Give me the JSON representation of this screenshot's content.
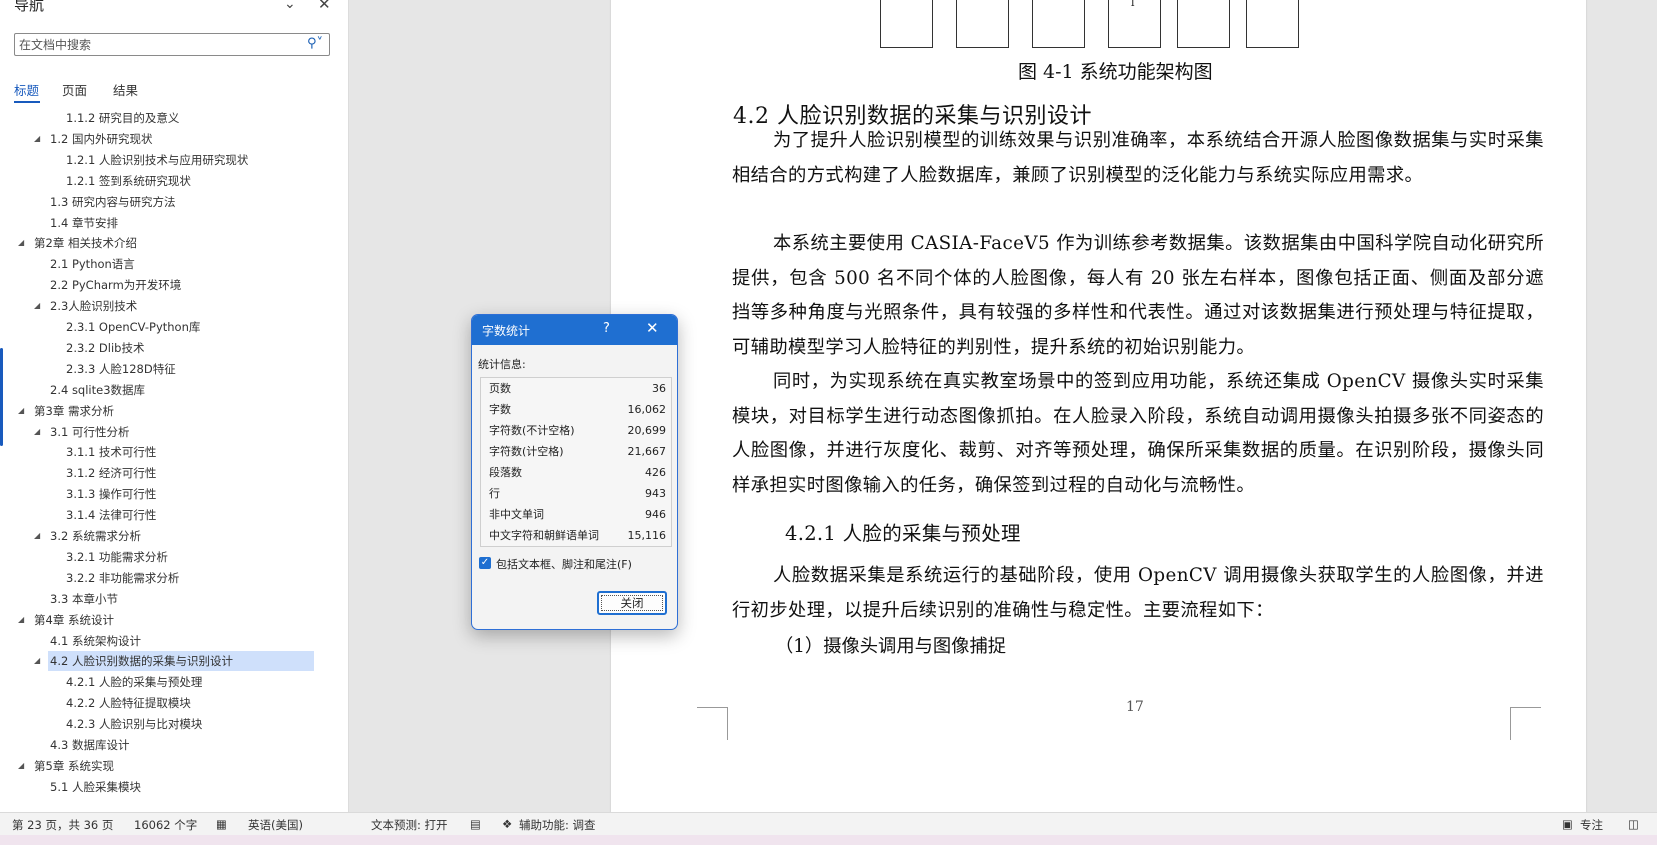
{
  "nav": {
    "title": "导航",
    "search_placeholder": "在文档中搜索",
    "tabs": [
      {
        "label": "标题",
        "active": true
      },
      {
        "label": "页面",
        "active": false
      },
      {
        "label": "结果",
        "active": false
      }
    ],
    "outline": [
      {
        "label": "1.1.2  研究目的及意义",
        "level": 3,
        "expanded": null,
        "selected": false
      },
      {
        "label": "1.2  国内外研究现状",
        "level": 2,
        "expanded": true,
        "selected": false
      },
      {
        "label": "1.2.1  人脸识别技术与应用研究现状",
        "level": 3,
        "expanded": null,
        "selected": false
      },
      {
        "label": "1.2.1  签到系统研究现状",
        "level": 3,
        "expanded": null,
        "selected": false
      },
      {
        "label": "1.3  研究内容与研究方法",
        "level": 2,
        "expanded": null,
        "selected": false
      },
      {
        "label": "1.4  章节安排",
        "level": 2,
        "expanded": null,
        "selected": false
      },
      {
        "label": "第2章  相关技术介绍",
        "level": 1,
        "expanded": true,
        "selected": false
      },
      {
        "label": "2.1 Python语言",
        "level": 2,
        "expanded": null,
        "selected": false
      },
      {
        "label": "2.2 PyCharm为开发环境",
        "level": 2,
        "expanded": null,
        "selected": false
      },
      {
        "label": "2.3人脸识别技术",
        "level": 2,
        "expanded": true,
        "selected": false
      },
      {
        "label": "2.3.1 OpenCV-Python库",
        "level": 3,
        "expanded": null,
        "selected": false
      },
      {
        "label": "2.3.2 Dlib技术",
        "level": 3,
        "expanded": null,
        "selected": false
      },
      {
        "label": "2.3.3 人脸128D特征",
        "level": 3,
        "expanded": null,
        "selected": false
      },
      {
        "label": "2.4 sqlite3数据库",
        "level": 2,
        "expanded": null,
        "selected": false
      },
      {
        "label": "第3章 需求分析",
        "level": 1,
        "expanded": true,
        "selected": false
      },
      {
        "label": "3.1 可行性分析",
        "level": 2,
        "expanded": true,
        "selected": false
      },
      {
        "label": "3.1.1 技术可行性",
        "level": 3,
        "expanded": null,
        "selected": false
      },
      {
        "label": "3.1.2 经济可行性",
        "level": 3,
        "expanded": null,
        "selected": false
      },
      {
        "label": "3.1.3 操作可行性",
        "level": 3,
        "expanded": null,
        "selected": false
      },
      {
        "label": "3.1.4 法律可行性",
        "level": 3,
        "expanded": null,
        "selected": false
      },
      {
        "label": "3.2 系统需求分析",
        "level": 2,
        "expanded": true,
        "selected": false
      },
      {
        "label": "3.2.1 功能需求分析",
        "level": 3,
        "expanded": null,
        "selected": false
      },
      {
        "label": "3.2.2 非功能需求分析",
        "level": 3,
        "expanded": null,
        "selected": false
      },
      {
        "label": "3.3 本章小节",
        "level": 2,
        "expanded": null,
        "selected": false
      },
      {
        "label": "第4章 系统设计",
        "level": 1,
        "expanded": true,
        "selected": false
      },
      {
        "label": "4.1 系统架构设计",
        "level": 2,
        "expanded": null,
        "selected": false
      },
      {
        "label": "4.2 人脸识别数据的采集与识别设计",
        "level": 2,
        "expanded": true,
        "selected": true
      },
      {
        "label": "4.2.1 人脸的采集与预处理",
        "level": 3,
        "expanded": null,
        "selected": false
      },
      {
        "label": "4.2.2 人脸特征提取模块",
        "level": 3,
        "expanded": null,
        "selected": false
      },
      {
        "label": "4.2.3 人脸识别与比对模块",
        "level": 3,
        "expanded": null,
        "selected": false
      },
      {
        "label": "4.3 数据库设计",
        "level": 2,
        "expanded": null,
        "selected": false
      },
      {
        "label": "第5章 系统实现",
        "level": 1,
        "expanded": true,
        "selected": false
      },
      {
        "label": "5.1 人脸采集模块",
        "level": 2,
        "expanded": null,
        "selected": false
      }
    ]
  },
  "document": {
    "figure_box_label": "l",
    "figure_caption": "图 4-1  系统功能架构图",
    "heading_4_2": "4.2  人脸识别数据的采集与识别设计",
    "para1": "为了提升人脸识别模型的训练效果与识别准确率，本系统结合开源人脸图像数据集与实时采集相结合的方式构建了人脸数据库，兼顾了识别模型的泛化能力与系统实际应用需求。",
    "para2": "本系统主要使用 CASIA-FaceV5 作为训练参考数据集。该数据集由中国科学院自动化研究所提供，包含 500 名不同个体的人脸图像，每人有 20 张左右样本，图像包括正面、侧面及部分遮挡等多种角度与光照条件，具有较强的多样性和代表性。通过对该数据集进行预处理与特征提取，可辅助模型学习人脸特征的判别性，提升系统的初始识别能力。",
    "para3": "同时，为实现系统在真实教室场景中的签到应用功能，系统还集成 OpenCV 摄像头实时采集模块，对目标学生进行动态图像抓拍。在人脸录入阶段，系统自动调用摄像头拍摄多张不同姿态的人脸图像，并进行灰度化、裁剪、对齐等预处理，确保所采集数据的质量。在识别阶段，摄像头同样承担实时图像输入的任务，确保签到过程的自动化与流畅性。",
    "heading_4_2_1": "4.2.1  人脸的采集与预处理",
    "para4": "人脸数据采集是系统运行的基础阶段，使用 OpenCV 调用摄像头获取学生的人脸图像，并进行初步处理，以提升后续识别的准确性与稳定性。主要流程如下：",
    "step1": "（1）摄像头调用与图像捕捉",
    "page_number": "17"
  },
  "dialog": {
    "title": "字数统计",
    "help": "?",
    "stats_label": "统计信息:",
    "stats": [
      {
        "label": "页数",
        "value": "36"
      },
      {
        "label": "字数",
        "value": "16,062"
      },
      {
        "label": "字符数(不计空格)",
        "value": "20,699"
      },
      {
        "label": "字符数(计空格)",
        "value": "21,667"
      },
      {
        "label": "段落数",
        "value": "426"
      },
      {
        "label": "行",
        "value": "943"
      },
      {
        "label": "非中文单词",
        "value": "946"
      },
      {
        "label": "中文字符和朝鲜语单词",
        "value": "15,116"
      }
    ],
    "include_checkbox_label": "包括文本框、脚注和尾注(F)",
    "include_checked": true,
    "close_button": "关闭"
  },
  "statusbar": {
    "page": "第 23 页，共 36 页",
    "words": "16062 个字",
    "language": "英语(美国)",
    "text_prediction": "文本预测: 打开",
    "accessibility": "辅助功能: 调查",
    "focus": "专注"
  },
  "colors": {
    "accent": "#185abd",
    "dialog_title": "#1f6fd1",
    "selection": "#cfe0fb"
  }
}
